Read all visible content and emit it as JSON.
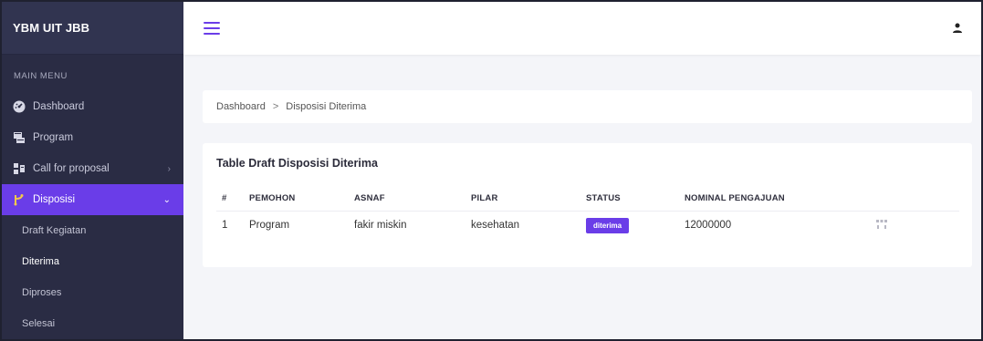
{
  "brand": {
    "title": "YBM UIT JBB"
  },
  "sidebar": {
    "menu_title": "MAIN MENU",
    "items": [
      {
        "label": "Dashboard",
        "icon": "dashboard-icon"
      },
      {
        "label": "Program",
        "icon": "program-icon"
      },
      {
        "label": "Call for proposal",
        "icon": "call-for-proposal-icon"
      },
      {
        "label": "Disposisi",
        "icon": "disposisi-icon"
      }
    ],
    "sub_items": [
      {
        "label": "Draft Kegiatan"
      },
      {
        "label": "Diterima"
      },
      {
        "label": "Diproses"
      },
      {
        "label": "Selesai"
      }
    ]
  },
  "breadcrumb": {
    "home": "Dashboard",
    "separator": ">",
    "current": "Disposisi Diterima"
  },
  "table": {
    "title": "Table Draft Disposisi Diterima",
    "headers": [
      "#",
      "PEMOHON",
      "ASNAF",
      "PILAR",
      "STATUS",
      "NOMINAL PENGAJUAN"
    ],
    "rows": [
      {
        "no": "1",
        "pemohon": "Program",
        "asnaf": "fakir miskin",
        "pilar": "kesehatan",
        "status": "diterima",
        "nominal": "12000000"
      }
    ]
  },
  "colors": {
    "accent": "#6a3de8",
    "sidebar": "#2a2c44",
    "background": "#f4f5f9"
  }
}
